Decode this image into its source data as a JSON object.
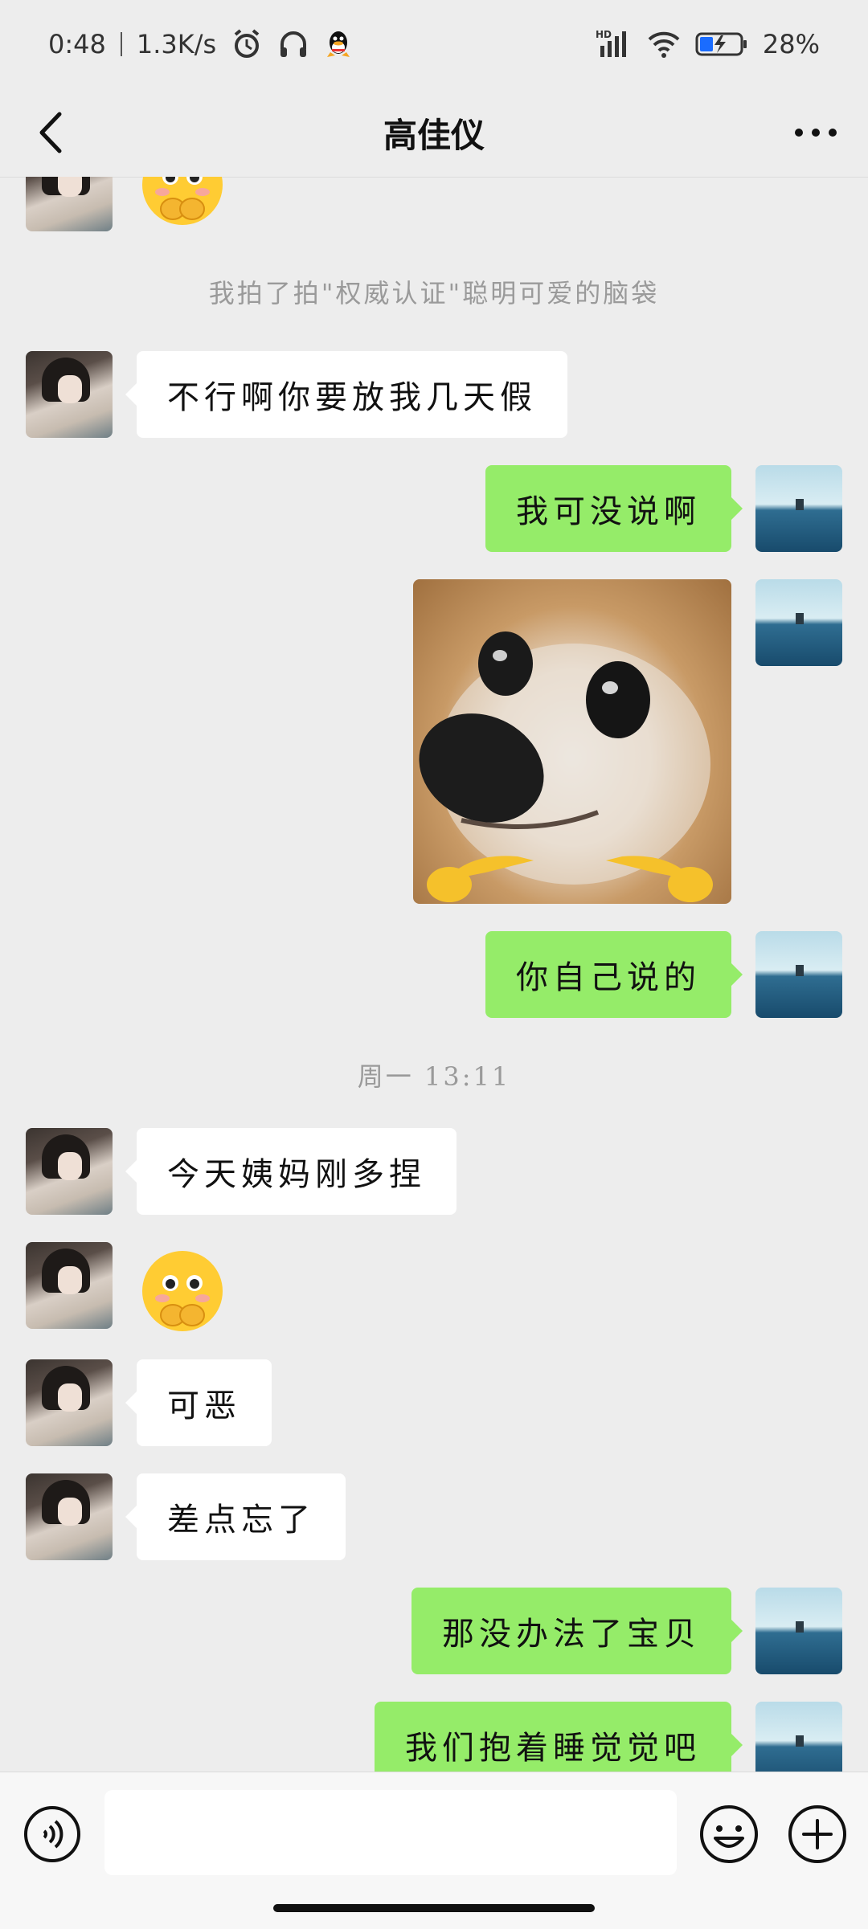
{
  "status_bar": {
    "time": "0:48",
    "net_speed": "1.3K/s",
    "battery": "28%",
    "signal_label": "HD"
  },
  "header": {
    "title": "高佳仪"
  },
  "chat": {
    "system_pat": "我拍了拍\"权威认证\"聪明可爱的脑袋",
    "msg_1": "不行啊你要放我几天假",
    "msg_2": "我可没说啊",
    "msg_3": "你自己说的",
    "timestamp": "周一 13:11",
    "msg_4": "今天姨妈刚多捏",
    "msg_5": "可恶",
    "msg_6": "差点忘了",
    "msg_7": "那没办法了宝贝",
    "msg_8": "我们抱着睡觉觉吧"
  },
  "colors": {
    "sent_bubble": "#95ec69",
    "received_bubble": "#ffffff",
    "background": "#ededed"
  },
  "input": {
    "value": ""
  }
}
